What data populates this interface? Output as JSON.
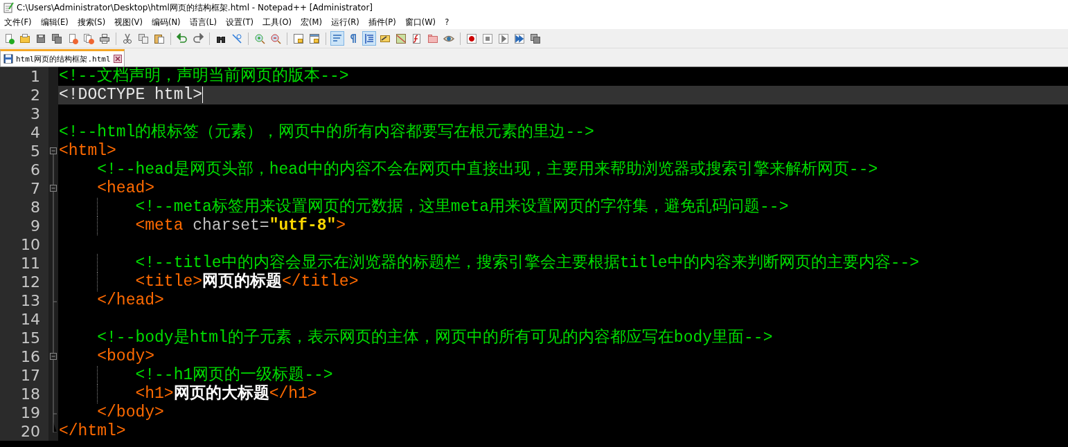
{
  "window": {
    "title": "C:\\Users\\Administrator\\Desktop\\html网页的结构框架.html - Notepad++ [Administrator]"
  },
  "menu": [
    "文件(F)",
    "编辑(E)",
    "搜索(S)",
    "视图(V)",
    "编码(N)",
    "语言(L)",
    "设置(T)",
    "工具(O)",
    "宏(M)",
    "运行(R)",
    "插件(P)",
    "窗口(W)",
    "?"
  ],
  "toolbar": [
    [
      {
        "kind": "new",
        "on": false
      },
      {
        "kind": "open",
        "on": false
      },
      {
        "kind": "save",
        "on": false
      },
      {
        "kind": "saveall",
        "on": false
      },
      {
        "kind": "close",
        "on": false
      },
      {
        "kind": "closeall",
        "on": false
      },
      {
        "kind": "print",
        "on": false
      }
    ],
    [
      {
        "kind": "cut",
        "on": false
      },
      {
        "kind": "copy",
        "on": false
      },
      {
        "kind": "paste",
        "on": false
      }
    ],
    [
      {
        "kind": "undo",
        "on": false
      },
      {
        "kind": "redo",
        "on": false
      }
    ],
    [
      {
        "kind": "find",
        "on": false
      },
      {
        "kind": "replace",
        "on": false
      }
    ],
    [
      {
        "kind": "zoomin",
        "on": false
      },
      {
        "kind": "zoomout",
        "on": false
      }
    ],
    [
      {
        "kind": "syncv",
        "on": false
      },
      {
        "kind": "synch",
        "on": false
      }
    ],
    [
      {
        "kind": "wrap",
        "on": true
      },
      {
        "kind": "pilcrow",
        "on": false
      },
      {
        "kind": "guide",
        "on": true
      },
      {
        "kind": "udl",
        "on": false
      },
      {
        "kind": "map",
        "on": false
      },
      {
        "kind": "func",
        "on": false
      },
      {
        "kind": "folder",
        "on": false
      },
      {
        "kind": "eye",
        "on": false
      }
    ],
    [
      {
        "kind": "record",
        "on": false
      },
      {
        "kind": "stop",
        "on": false
      },
      {
        "kind": "play",
        "on": false
      },
      {
        "kind": "playmulti",
        "on": false
      },
      {
        "kind": "savemacro",
        "on": false
      }
    ]
  ],
  "tabs": [
    {
      "label": "html网页的结构框架.html",
      "selected": true
    }
  ],
  "lines": [
    {
      "number": "1",
      "kind": "plain",
      "selected": false,
      "tokens": [
        {
          "kind": "comment",
          "text": "<!--文档声明，声明当前网页的版本-->"
        }
      ]
    },
    {
      "number": "2",
      "kind": "plain",
      "selected": true,
      "tokens": [
        {
          "kind": "doctype",
          "text": "<!DOCTYPE html>"
        }
      ]
    },
    {
      "number": "3",
      "kind": "plain",
      "selected": false
    },
    {
      "number": "4",
      "kind": "plain",
      "selected": false,
      "tokens": [
        {
          "kind": "comment",
          "text": "<!--html的根标签（元素），网页中的所有内容都要写在根元素的里边-->"
        }
      ]
    },
    {
      "number": "5",
      "kind": "fold-start",
      "selected": false,
      "tokens": [
        {
          "kind": "tag",
          "text": "<html>"
        }
      ]
    },
    {
      "number": "6",
      "kind": "fold-line",
      "selected": false,
      "tokens": [
        {
          "kind": "comment",
          "text": "    <!--head是网页头部，head中的内容不会在网页中直接出现，主要用来帮助浏览器或搜索引擎来解析网页-->"
        }
      ]
    },
    {
      "number": "7",
      "kind": "fold-start",
      "selected": false,
      "tokens": [
        {
          "kind": "tag",
          "text": "    <head>"
        }
      ]
    },
    {
      "number": "8",
      "kind": "fold-line",
      "selected": false,
      "tokens": [
        {
          "kind": "comment",
          "text": "        <!--meta标签用来设置网页的元数据，这里meta用来设置网页的字符集，避免乱码问题-->"
        }
      ]
    },
    {
      "number": "9",
      "kind": "fold-line",
      "selected": false,
      "tokens": [
        {
          "kind": "tag",
          "text": "        <meta"
        },
        {
          "kind": "attr",
          "text": " charset="
        },
        {
          "kind": "value",
          "text": "\"utf-8\""
        },
        {
          "kind": "tag",
          "text": ">"
        }
      ]
    },
    {
      "number": "10",
      "kind": "fold-line",
      "selected": false
    },
    {
      "number": "11",
      "kind": "fold-line",
      "selected": false,
      "tokens": [
        {
          "kind": "comment",
          "text": "        <!--title中的内容会显示在浏览器的标题栏，搜索引擎会主要根据title中的内容来判断网页的主要内容-->"
        }
      ]
    },
    {
      "number": "12",
      "kind": "fold-line",
      "selected": false,
      "tokens": [
        {
          "kind": "tag",
          "text": "        <title>"
        },
        {
          "kind": "text",
          "text": "网页的标题"
        },
        {
          "kind": "tag",
          "text": "</title>"
        }
      ]
    },
    {
      "number": "13",
      "kind": "fold-end",
      "selected": false,
      "tokens": [
        {
          "kind": "tag",
          "text": "    </head>"
        }
      ]
    },
    {
      "number": "14",
      "kind": "fold-line",
      "selected": false
    },
    {
      "number": "15",
      "kind": "fold-line",
      "selected": false,
      "tokens": [
        {
          "kind": "comment",
          "text": "    <!--body是html的子元素，表示网页的主体，网页中的所有可见的内容都应写在body里面-->"
        }
      ]
    },
    {
      "number": "16",
      "kind": "fold-start",
      "selected": false,
      "tokens": [
        {
          "kind": "tag",
          "text": "    <body>"
        }
      ]
    },
    {
      "number": "17",
      "kind": "fold-line",
      "selected": false,
      "tokens": [
        {
          "kind": "comment",
          "text": "        <!--h1网页的一级标题-->"
        }
      ]
    },
    {
      "number": "18",
      "kind": "fold-line",
      "selected": false,
      "tokens": [
        {
          "kind": "tag",
          "text": "        <h1>"
        },
        {
          "kind": "text",
          "text": "网页的大标题"
        },
        {
          "kind": "tag",
          "text": "</h1>"
        }
      ]
    },
    {
      "number": "19",
      "kind": "fold-end",
      "selected": false,
      "tokens": [
        {
          "kind": "tag",
          "text": "    </body>"
        }
      ]
    },
    {
      "number": "20",
      "kind": "fold-last",
      "selected": false,
      "tokens": [
        {
          "kind": "tag",
          "text": "</html>"
        }
      ]
    }
  ]
}
